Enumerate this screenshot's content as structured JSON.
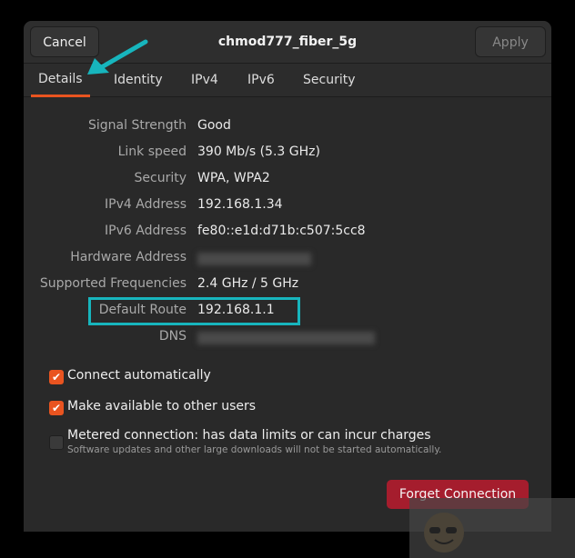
{
  "header": {
    "cancel_label": "Cancel",
    "title": "chmod777_fiber_5g",
    "apply_label": "Apply"
  },
  "tabs": [
    {
      "label": "Details"
    },
    {
      "label": "Identity"
    },
    {
      "label": "IPv4"
    },
    {
      "label": "IPv6"
    },
    {
      "label": "Security"
    }
  ],
  "details": [
    {
      "label": "Signal Strength",
      "value": "Good"
    },
    {
      "label": "Link speed",
      "value": "390 Mb/s (5.3 GHz)"
    },
    {
      "label": "Security",
      "value": "WPA, WPA2"
    },
    {
      "label": "IPv4 Address",
      "value": "192.168.1.34"
    },
    {
      "label": "IPv6 Address",
      "value": "fe80::e1d:d71b:c507:5cc8"
    },
    {
      "label": "Hardware Address"
    },
    {
      "label": "Supported Frequencies",
      "value": "2.4 GHz / 5 GHz"
    },
    {
      "label": "Default Route",
      "value": "192.168.1.1"
    },
    {
      "label": "DNS"
    }
  ],
  "options": [
    {
      "label": "Connect automatically",
      "checked": true
    },
    {
      "label": "Make available to other users",
      "checked": true
    },
    {
      "label": "Metered connection: has data limits or can incur charges",
      "sub": "Software updates and other large downloads will not be started automatically.",
      "checked": false
    }
  ],
  "forget_label": "Forget Connection",
  "colors": {
    "accent": "#e95420",
    "destructive": "#a51d2d",
    "annotation": "#17b5bd"
  }
}
